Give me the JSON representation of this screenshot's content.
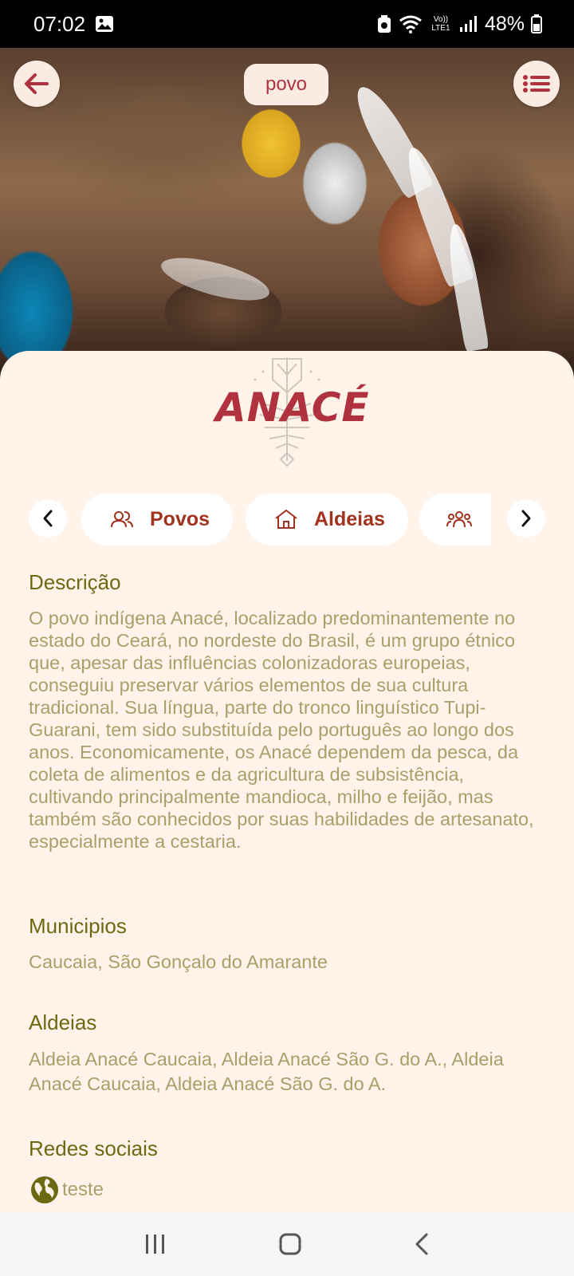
{
  "status_bar": {
    "time": "07:02",
    "network": "Vo)) LTE1",
    "battery": "48%"
  },
  "header": {
    "page_label": "povo",
    "back_icon": "arrow-left-icon",
    "menu_icon": "list-icon"
  },
  "logo": {
    "text": "ANACÉ"
  },
  "tabs": {
    "items": [
      {
        "label": "Povos",
        "icon": "people-icon"
      },
      {
        "label": "Aldeias",
        "icon": "house-icon"
      },
      {
        "label": "",
        "icon": "group-icon"
      }
    ]
  },
  "descricao": {
    "title": "Descrição",
    "text": "O povo indígena Anacé, localizado predominantemente no estado do Ceará, no nordeste do Brasil, é um grupo étnico que, apesar das influências colonizadoras europeias, conseguiu preservar vários elementos de sua cultura tradicional. Sua língua, parte do tronco linguístico Tupi-Guarani, tem sido substituída pelo português ao longo dos anos. Economicamente, os Anacé dependem da pesca, da coleta de alimentos e da agricultura de subsistência, cultivando principalmente mandioca, milho e feijão, mas também são conhecidos por suas habilidades de artesanato, especialmente a cestaria."
  },
  "municipios": {
    "title": "Municipios",
    "text": "Caucaia, São Gonçalo do Amarante"
  },
  "aldeias": {
    "title": "Aldeias",
    "text": "Aldeia Anacé Caucaia, Aldeia Anacé São G. do A., Aldeia Anacé Caucaia, Aldeia Anacé São G. do A."
  },
  "redes": {
    "title": "Redes sociais",
    "link_label": "teste",
    "link_icon": "globe-icon"
  },
  "colors": {
    "accent": "#b0323f",
    "heading": "#6b6a12",
    "body_text": "#a6a16a",
    "background": "#fff3ea"
  }
}
